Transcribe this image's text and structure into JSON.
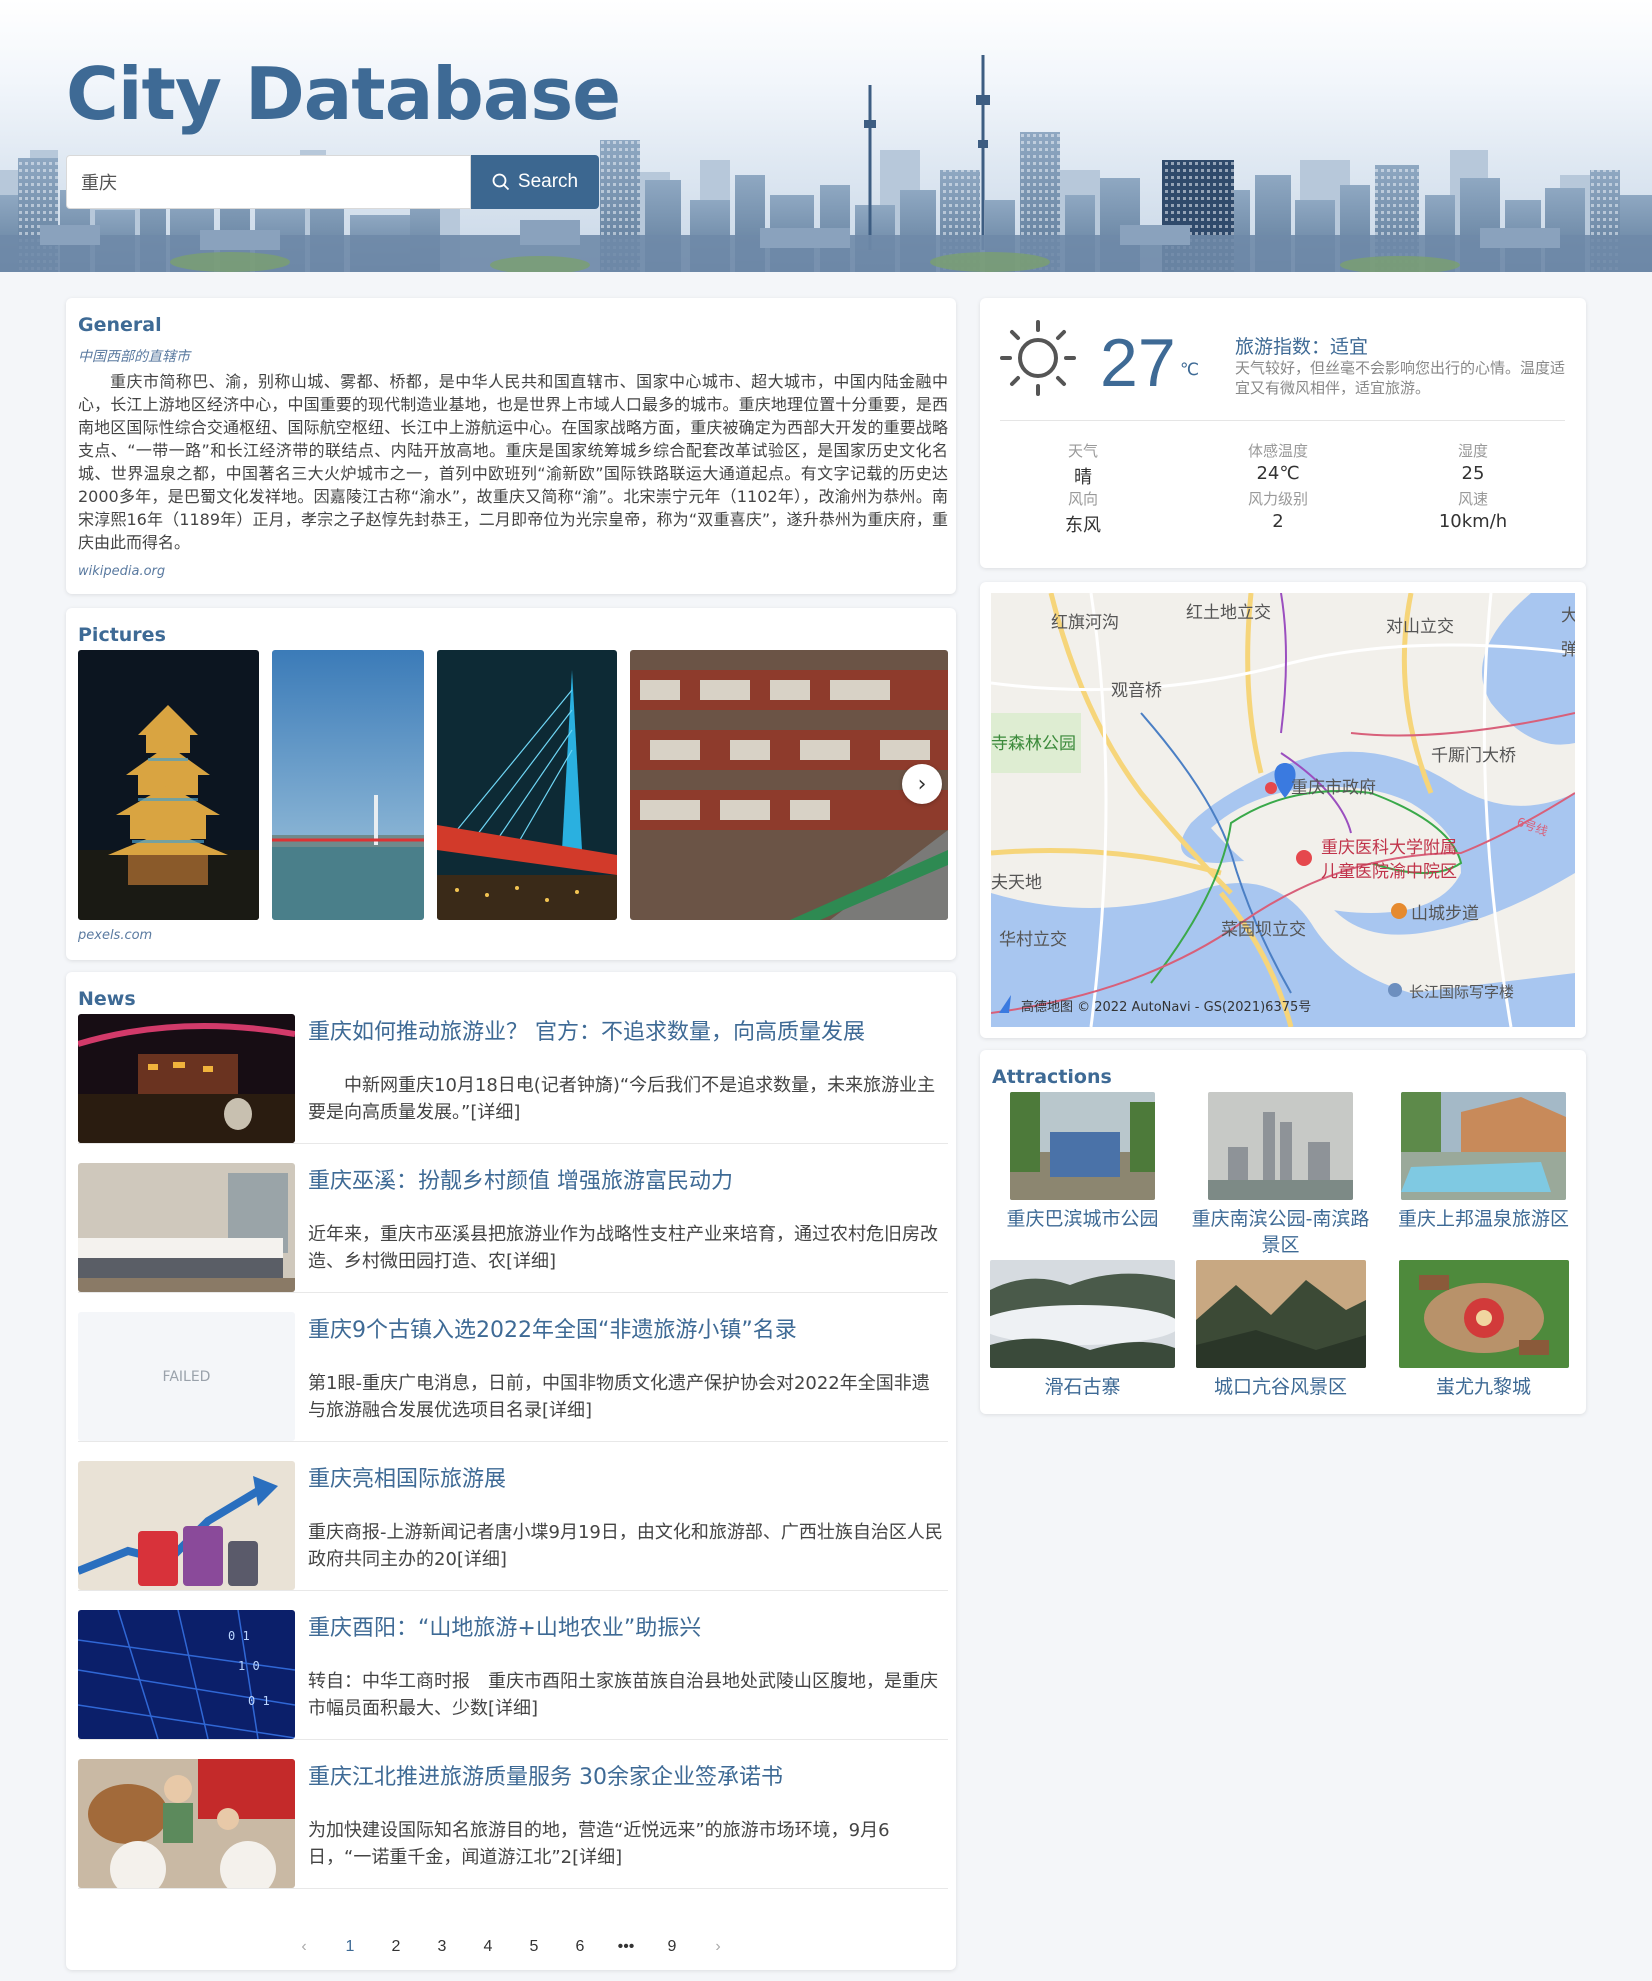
{
  "header": {
    "title": "City Database",
    "search_value": "重庆",
    "search_label": "Search"
  },
  "general": {
    "heading": "General",
    "subtitle": "中国西部的直辖市",
    "text": "重庆市简称巴、渝，别称山城、雾都、桥都，是中华人民共和国直辖市、国家中心城市、超大城市，中国内陆金融中心，长江上游地区经济中心，中国重要的现代制造业基地，也是世界上市域人口最多的城市。重庆地理位置十分重要，是西南地区国际性综合交通枢纽、国际航空枢纽、长江中上游航运中心。在国家战略方面，重庆被确定为西部大开发的重要战略支点、“一带一路”和长江经济带的联结点、内陆开放高地。重庆是国家统筹城乡综合配套改革试验区，是国家历史文化名城、世界温泉之都，中国著名三大火炉城市之一，首列中欧班列“渝新欧”国际铁路联运大通道起点。有文字记载的历史达2000多年，是巴蜀文化发祥地。因嘉陵江古称“渝水”，故重庆又简称“渝”。北宋崇宁元年（1102年），改渝州为恭州。南宋淳熙16年（1189年）正月，孝宗之子赵惇先封恭王，二月即帝位为光宗皇帝，称为“双重喜庆”，遂升恭州为重庆府，重庆由此而得名。",
    "source": "wikipedia.org"
  },
  "pictures": {
    "heading": "Pictures",
    "source": "pexels.com"
  },
  "news": {
    "heading": "News",
    "items": [
      {
        "title": "重庆如何推动旅游业？ 官方：不追求数量，向高质量发展",
        "body": "　　中新网重庆10月18日电(记者钟旖)“今后我们不是追求数量，未来旅游业主要是向高质量发展。”[详细]"
      },
      {
        "title": "重庆巫溪：扮靓乡村颜值 增强旅游富民动力",
        "body": "近年来，重庆市巫溪县把旅游业作为战略性支柱产业来培育，通过农村危旧房改造、乡村微田园打造、农[详细]"
      },
      {
        "title": "重庆9个古镇入选2022年全国“非遗旅游小镇”名录",
        "body": "第1眼-重庆广电消息，日前，中国非物质文化遗产保护协会对2022年全国非遗与旅游融合发展优选项目名录[详细]",
        "image_status": "FAILED"
      },
      {
        "title": "重庆亮相国际旅游展",
        "body": "重庆商报-上游新闻记者唐小堞9月19日，由文化和旅游部、广西壮族自治区人民政府共同主办的20[详细]"
      },
      {
        "title": "重庆酉阳：“山地旅游+山地农业”助振兴",
        "body": "转自：中华工商时报　重庆市酉阳土家族苗族自治县地处武陵山区腹地，是重庆市幅员面积最大、少数[详细]"
      },
      {
        "title": "重庆江北推进旅游质量服务 30余家企业签承诺书",
        "body": "为加快建设国际知名旅游目的地，营造“近悦远来”的旅游市场环境，9月6日，“一诺重千金，闻道游江北”2[详细]"
      }
    ],
    "pagination": {
      "prev": "‹",
      "pages": [
        "1",
        "2",
        "3",
        "4",
        "5",
        "6",
        "•••",
        "9"
      ],
      "next": "›",
      "current": "1"
    }
  },
  "weather": {
    "temp": "27",
    "unit": "℃",
    "index": "旅游指数：适宜",
    "desc": "天气较好，但丝毫不会影响您出行的心情。温度适宜又有微风相伴，适宜旅游。",
    "cells": [
      {
        "label": "天气",
        "value": "晴"
      },
      {
        "label": "体感温度",
        "value": "24℃"
      },
      {
        "label": "湿度",
        "value": "25"
      },
      {
        "label": "风向",
        "value": "东风"
      },
      {
        "label": "风力级别",
        "value": "2"
      },
      {
        "label": "风速",
        "value": "10km/h"
      }
    ],
    "icon": "sun-icon"
  },
  "map": {
    "labels": [
      "红旗河沟",
      "红土地立交",
      "对山立交",
      "观音桥",
      "寺森林公园",
      "千厮门大桥",
      "重庆市政府",
      "重庆医科大学附属",
      "儿童医院渝中院区",
      "6号线",
      "大",
      "弹",
      "夫天地",
      "山城步道",
      "华村立交",
      "菜园坝立交",
      "长江国际写字楼"
    ],
    "attribution": "高德地图 © 2022 AutoNavi - GS(2021)6375号"
  },
  "attractions": {
    "heading": "Attractions",
    "items": [
      "重庆巴滨城市公园",
      "重庆南滨公园-南滨路景区",
      "重庆上邦温泉旅游区",
      "滑石古寨",
      "城口亢谷风景区",
      "蚩尤九黎城"
    ]
  },
  "colors": {
    "accent": "#3e6a95",
    "button": "#3c6790"
  }
}
